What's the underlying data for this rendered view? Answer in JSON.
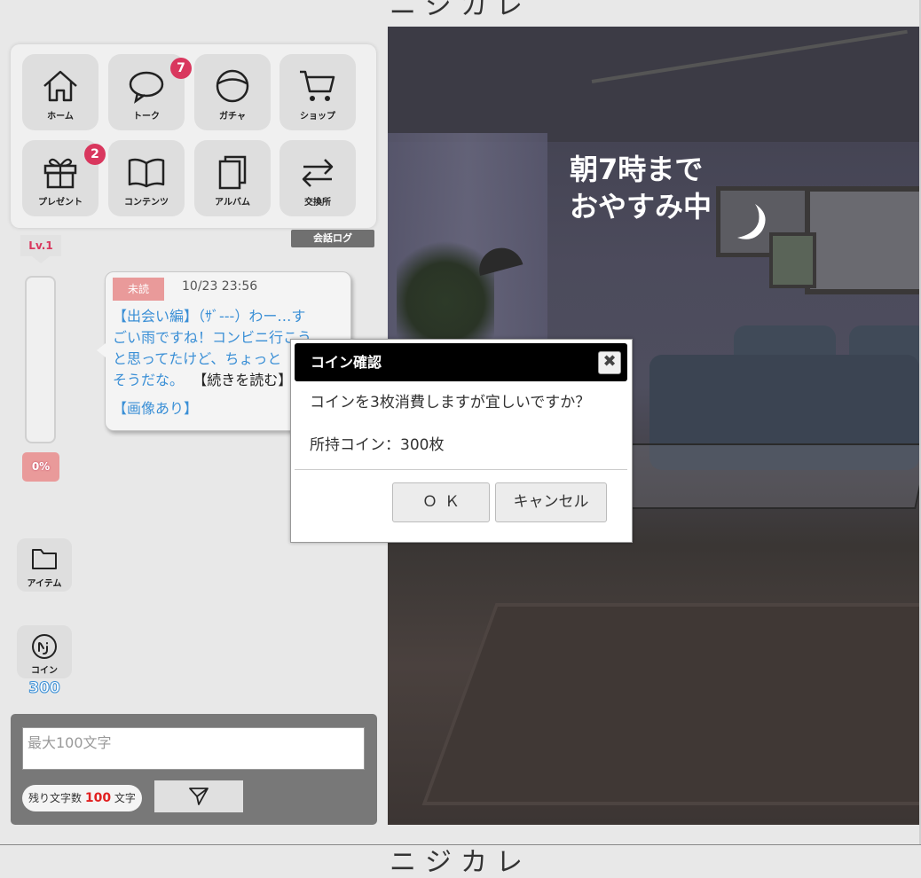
{
  "app": {
    "brand": "ニジカレ"
  },
  "menu": {
    "items": [
      {
        "label": "ホーム",
        "icon": "home-icon",
        "badge": ""
      },
      {
        "label": "トーク",
        "icon": "chat-bubble-icon",
        "badge": "7"
      },
      {
        "label": "ガチャ",
        "icon": "gacha-ball-icon",
        "badge": ""
      },
      {
        "label": "ショップ",
        "icon": "cart-icon",
        "badge": ""
      },
      {
        "label": "プレゼント",
        "icon": "gift-icon",
        "badge": "2"
      },
      {
        "label": "コンテンツ",
        "icon": "book-icon",
        "badge": ""
      },
      {
        "label": "アルバム",
        "icon": "album-icon",
        "badge": ""
      },
      {
        "label": "交換所",
        "icon": "exchange-arrows-icon",
        "badge": ""
      }
    ],
    "badge_color": "#d9375e"
  },
  "conversation_log_button": "会話ログ",
  "level": {
    "label": "Lv.1",
    "percent_label": "0%",
    "progress": 0
  },
  "message": {
    "status": "未読",
    "timestamp": "10/23 23:56",
    "text_lines": [
      "【出会い編】（ｻﾞ---）わー…す",
      "ごい雨ですね！コンビニ行こう",
      "と思ってたけど、ちょっと",
      "そうだな。"
    ],
    "read_more": "【続きを読む】",
    "image_note": "【画像あり】",
    "link_color": "#3a8fd6"
  },
  "side_buttons": {
    "item": {
      "label": "アイテム",
      "icon": "folder-icon"
    },
    "coin": {
      "label": "コイン",
      "icon": "coin-icon",
      "count": "300"
    }
  },
  "input": {
    "placeholder": "最大100文字",
    "remaining_prefix": "残り文字数",
    "remaining_count": "100",
    "remaining_suffix": "文字",
    "send_icon": "send-paper-plane-icon"
  },
  "scene": {
    "status_line1": "朝7時まで",
    "status_line2": "おやすみ中",
    "moon_icon": "crescent-moon-icon"
  },
  "dialog": {
    "title": "コイン確認",
    "close_symbol": "✖",
    "message": "コインを3枚消費しますが宜しいですか？",
    "balance": "所持コイン：300枚",
    "ok_label": "ＯＫ",
    "cancel_label": "キャンセル"
  }
}
